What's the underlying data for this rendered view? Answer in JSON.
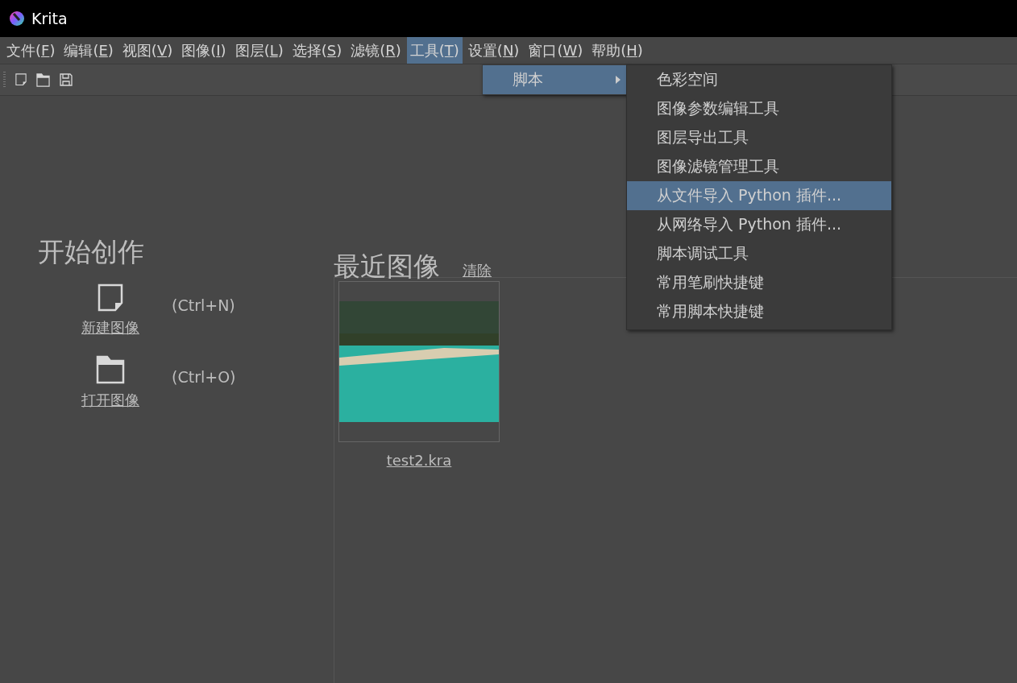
{
  "window": {
    "title": "Krita"
  },
  "menu_bar": [
    {
      "before": "文件(",
      "key": "F",
      "after": ")",
      "selected": false
    },
    {
      "before": "编辑(",
      "key": "E",
      "after": ")",
      "selected": false
    },
    {
      "before": "视图(",
      "key": "V",
      "after": ")",
      "selected": false
    },
    {
      "before": "图像(",
      "key": "I",
      "after": ")",
      "selected": false
    },
    {
      "before": "图层(",
      "key": "L",
      "after": ")",
      "selected": false
    },
    {
      "before": "选择(",
      "key": "S",
      "after": ")",
      "selected": false
    },
    {
      "before": "滤镜(",
      "key": "R",
      "after": ")",
      "selected": false
    },
    {
      "before": "工具(",
      "key": "T",
      "after": ")",
      "selected": true
    },
    {
      "before": "设置(",
      "key": "N",
      "after": ")",
      "selected": false
    },
    {
      "before": "窗口(",
      "key": "W",
      "after": ")",
      "selected": false
    },
    {
      "before": "帮助(",
      "key": "H",
      "after": ")",
      "selected": false
    }
  ],
  "tools_menu": [
    {
      "label": "脚本",
      "selected": true
    }
  ],
  "scripts_submenu": [
    {
      "label": "色彩空间",
      "selected": false
    },
    {
      "label": "图像参数编辑工具",
      "selected": false
    },
    {
      "label": "图层导出工具",
      "selected": false
    },
    {
      "label": "图像滤镜管理工具",
      "selected": false
    },
    {
      "label": "从文件导入 Python 插件...",
      "selected": true
    },
    {
      "label": "从网络导入 Python 插件...",
      "selected": false
    },
    {
      "label": "脚本调试工具",
      "selected": false
    },
    {
      "label": "常用笔刷快捷键",
      "selected": false
    },
    {
      "label": "常用脚本快捷键",
      "selected": false
    }
  ],
  "start": {
    "title": "开始创作",
    "actions": [
      {
        "kind": "new",
        "label": "新建图像",
        "shortcut": "(Ctrl+N)"
      },
      {
        "kind": "open",
        "label": "打开图像",
        "shortcut": "(Ctrl+O)"
      }
    ]
  },
  "recent": {
    "title": "最近图像",
    "clear": "清除",
    "files": [
      {
        "name": "test2.kra"
      }
    ]
  }
}
